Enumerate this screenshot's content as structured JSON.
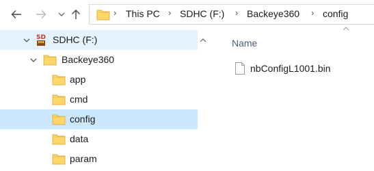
{
  "toolbar": {
    "back_icon": "arrow-left-icon",
    "forward_icon": "arrow-right-icon",
    "recent_icon": "chevron-down-icon",
    "up_icon": "arrow-up-icon"
  },
  "address": {
    "crumbs": [
      "This PC",
      "SDHC (F:)",
      "Backeye360",
      "config"
    ]
  },
  "nav_pane": {
    "items": [
      {
        "label": "SDHC (F:)",
        "icon": "sd-card-icon",
        "expanded": true,
        "state": "hover"
      },
      {
        "label": "Backeye360",
        "icon": "folder-icon",
        "expanded": true,
        "state": "normal"
      },
      {
        "label": "app",
        "icon": "folder-icon",
        "state": "normal"
      },
      {
        "label": "cmd",
        "icon": "folder-icon",
        "state": "normal"
      },
      {
        "label": "config",
        "icon": "folder-icon",
        "state": "selected"
      },
      {
        "label": "data",
        "icon": "folder-icon",
        "state": "normal"
      },
      {
        "label": "param",
        "icon": "folder-icon",
        "state": "normal"
      }
    ]
  },
  "content": {
    "columns": [
      "Name"
    ],
    "files": [
      {
        "name": "nbConfigL1001.bin",
        "icon": "file-icon"
      }
    ]
  },
  "colors": {
    "selected": "#cce8ff",
    "hover": "#e5f3ff",
    "folder": "#ffd766",
    "header_text": "#4c607a"
  }
}
